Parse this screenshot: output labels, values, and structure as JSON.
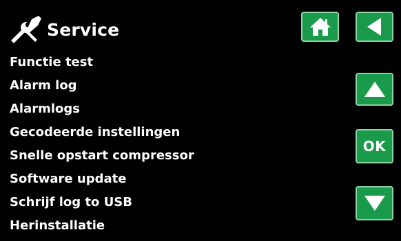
{
  "header": {
    "title": "Service",
    "title_icon": "tools-icon",
    "home_icon": "home-icon",
    "back_icon": "back-arrow-icon"
  },
  "menu": {
    "items": [
      "Functie test",
      "Alarm log",
      "Alarmlogs",
      "Gecodeerde instellingen",
      "Snelle opstart compressor",
      "Software update",
      "Schrijf log to USB",
      "Herinstallatie"
    ]
  },
  "nav": {
    "up_icon": "arrow-up-icon",
    "ok_label": "OK",
    "down_icon": "arrow-down-icon"
  },
  "colors": {
    "background": "#000000",
    "text": "#ffffff",
    "button_fill": "#1a9b4c",
    "button_border": "#8fd4a4"
  }
}
